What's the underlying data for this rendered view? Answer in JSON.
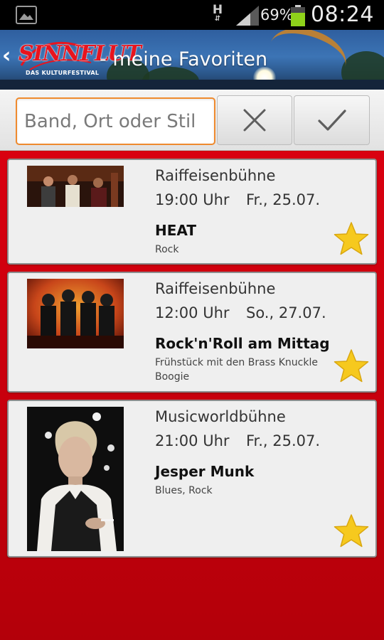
{
  "status_bar": {
    "network": "H",
    "battery_percent": "69%",
    "battery_level": 0.69,
    "time": "08:24"
  },
  "header": {
    "logo_text": "SINNFLUT",
    "logo_subtitle": "DAS KULTURFESTIVAL",
    "title": "- meine Favoriten",
    "back_icon": "chevron-left-icon"
  },
  "search": {
    "placeholder": "Band, Ort oder Stil",
    "value": "",
    "clear_icon": "close-icon",
    "confirm_icon": "checkmark-icon"
  },
  "favorites": [
    {
      "venue": "Raiffeisenbühne",
      "time": "19:00 Uhr",
      "date": "Fr., 25.07.",
      "artist": "HEAT",
      "genre": "Rock",
      "favorite": true
    },
    {
      "venue": "Raiffeisenbühne",
      "time": "12:00 Uhr",
      "date": "So., 27.07.",
      "artist": "Rock'n'Roll am Mittag",
      "genre": "Frühstück mit den Brass Knuckle Boogie",
      "favorite": true
    },
    {
      "venue": "Musicworldbühne",
      "time": "21:00 Uhr",
      "date": "Fr., 25.07.",
      "artist": "Jesper Munk",
      "genre": "Blues, Rock",
      "favorite": true
    }
  ],
  "colors": {
    "accent_orange": "#ef8a2e",
    "list_background": "#c8000a",
    "star": "#f6c91e"
  }
}
